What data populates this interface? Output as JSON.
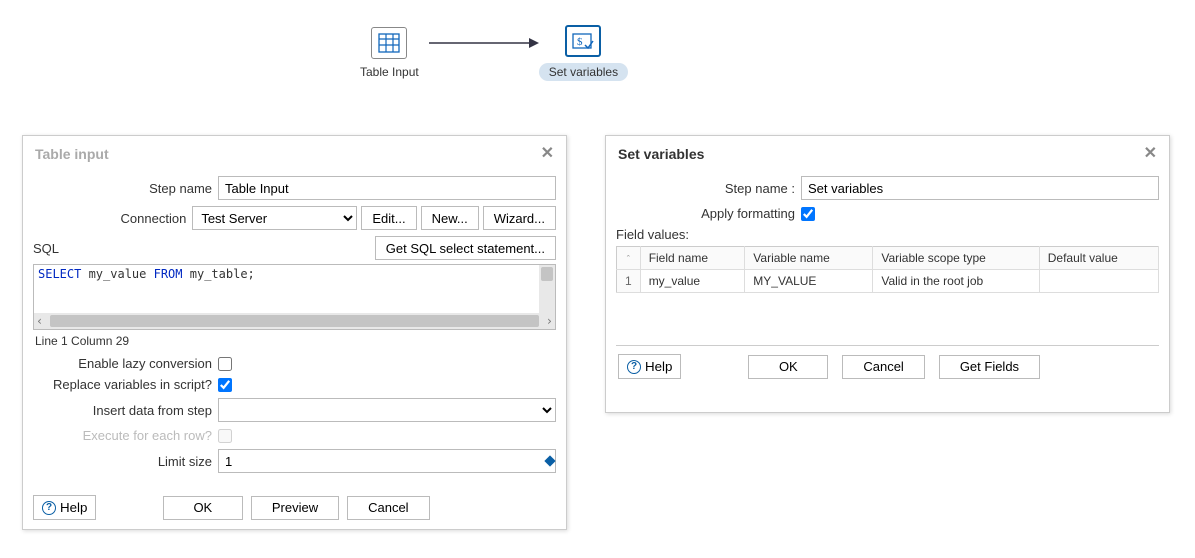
{
  "flow": {
    "node1": {
      "label": "Table Input"
    },
    "node2": {
      "label": "Set variables"
    }
  },
  "left": {
    "title": "Table input",
    "step_name_label": "Step name",
    "step_name_value": "Table Input",
    "connection_label": "Connection",
    "connection_value": "Test Server",
    "edit_btn": "Edit...",
    "new_btn": "New...",
    "wizard_btn": "Wizard...",
    "sql_label": "SQL",
    "get_sql_btn": "Get SQL select statement...",
    "sql_kw1": "SELECT",
    "sql_mid": " my_value ",
    "sql_kw2": "FROM",
    "sql_end": " my_table;",
    "cursor_status": "Line 1 Column 29",
    "lazy_label": "Enable lazy conversion",
    "replace_label": "Replace variables in script?",
    "insert_label": "Insert data from step",
    "execute_label": "Execute for each row?",
    "limit_label": "Limit size",
    "limit_value": "1",
    "help": "Help",
    "ok": "OK",
    "preview": "Preview",
    "cancel": "Cancel"
  },
  "right": {
    "title": "Set variables",
    "step_name_label": "Step name :",
    "step_name_value": "Set variables",
    "apply_label": "Apply formatting",
    "field_values_label": "Field values:",
    "col_rownum": "^",
    "col_field": "Field name",
    "col_var": "Variable name",
    "col_scope": "Variable scope type",
    "col_default": "Default value",
    "row1_num": "1",
    "row1_field": "my_value",
    "row1_var": "MY_VALUE",
    "row1_scope": "Valid in the root job",
    "row1_default": "",
    "help": "Help",
    "ok": "OK",
    "cancel": "Cancel",
    "get_fields": "Get Fields"
  }
}
